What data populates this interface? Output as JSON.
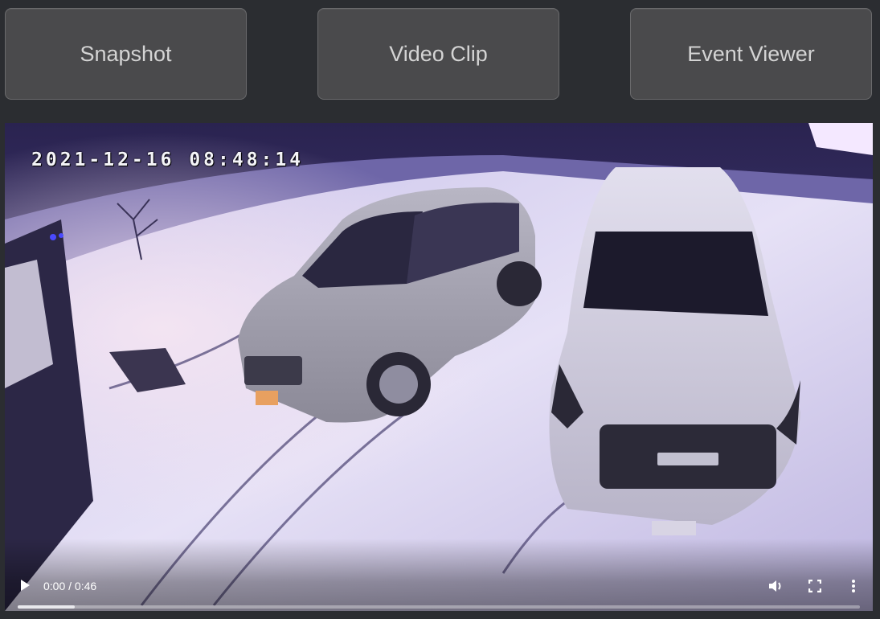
{
  "toolbar": {
    "snapshot_label": "Snapshot",
    "clip_label": "Video Clip",
    "events_label": "Event Viewer"
  },
  "video": {
    "overlay_timestamp": "2021-12-16 08:48:14",
    "scene_description_icons": [
      "play-icon",
      "volume-icon",
      "fullscreen-icon",
      "more-options-icon"
    ],
    "time_display": "0:00 / 0:46",
    "buffered_fraction": 0.068,
    "colors": {
      "snow": "#d8d2ee",
      "night_tint": "#4a3f8a",
      "page_bg": "#2b2d31",
      "button_bg": "#4a4a4c"
    }
  }
}
